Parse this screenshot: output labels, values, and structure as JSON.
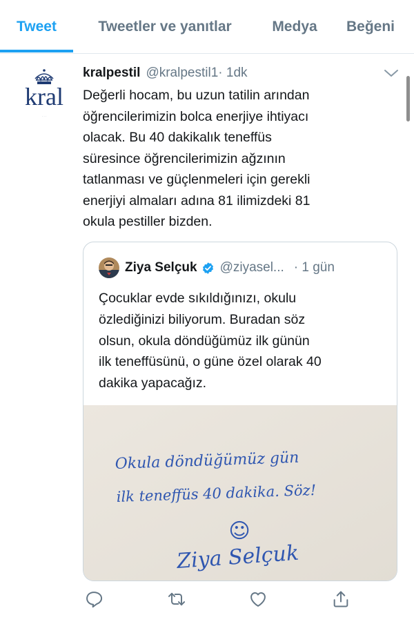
{
  "tabs": [
    {
      "label": "Tweet",
      "active": true
    },
    {
      "label": "Tweetler ve yanıtlar",
      "active": false
    },
    {
      "label": "Medya",
      "active": false
    },
    {
      "label": "Beğeni",
      "active": false
    }
  ],
  "tweet": {
    "avatar_logo_text": "kral",
    "author_name": "kralpestil",
    "author_handle": "@kralpestil1",
    "time": "· 1dk",
    "text": "Değerli hocam, bu uzun tatilin arından\nöğrencilerimizin bolca enerjiye ihtiyacı\nolacak. Bu 40 dakikalık teneffüs\nsüresince öğrencilerimizin ağzının\ntatlanması ve güçlenmeleri için gerekli\nenerjiyi almaları adına 81 ilimizdeki 81\nokula pestiller bizden."
  },
  "quote": {
    "author_name": "Ziya Selçuk",
    "author_handle": "@ziyasel...",
    "time": "· 1 gün",
    "verified": true,
    "text": "Çocuklar evde sıkıldığınızı, okulu\nözlediğinizi biliyorum. Buradan söz\nolsun, okula döndüğümüz ilk günün\nilk teneffüsünü, o güne özel olarak 40\ndakika yapacağız.",
    "image_note_line1": "Okula döndüğümüz gün",
    "image_note_line2": "ilk teneffüs 40 dakika. Söz!",
    "image_smiley": "☺",
    "image_signature": "Ziya Selçuk"
  },
  "icons": {
    "reply": "reply-icon",
    "retweet": "retweet-icon",
    "like": "heart-icon",
    "share": "share-icon",
    "menu": "chevron-down-icon",
    "verified": "verified-badge-icon"
  },
  "colors": {
    "accent": "#1da1f2",
    "secondary_text": "#657786",
    "border": "#e1e8ed",
    "handwriting": "#2f56b0"
  }
}
